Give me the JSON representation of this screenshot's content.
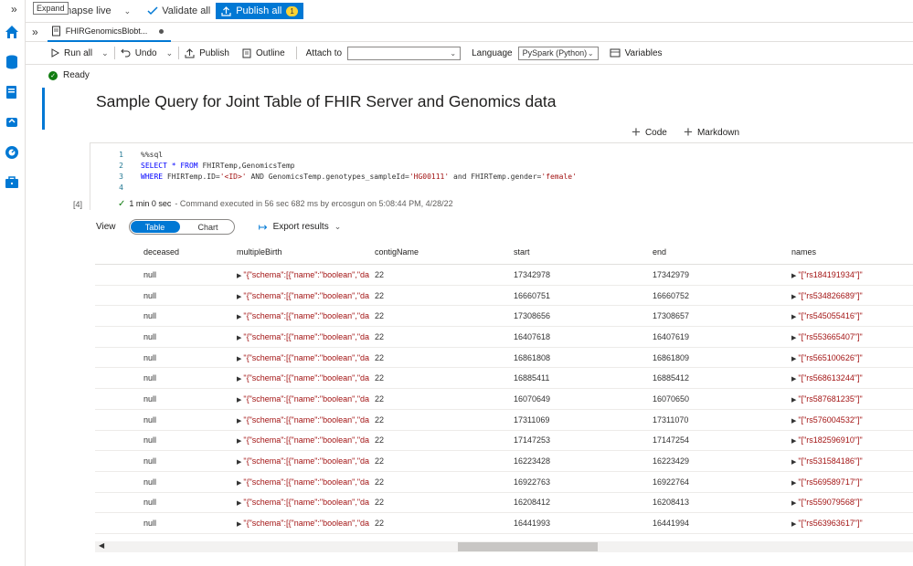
{
  "tooltip": "Expand",
  "topbar": {
    "workspace": "nnapse live",
    "validate_label": "Validate all",
    "publish_label": "Publish all",
    "publish_count": "1",
    "accent": "#0078d4"
  },
  "tab": {
    "label": "FHIRGenomicsBlobt..."
  },
  "toolbar": {
    "run_all": "Run all",
    "undo": "Undo",
    "publish": "Publish",
    "outline": "Outline",
    "attach_to_label": "Attach to",
    "attach_to_value": "",
    "language_label": "Language",
    "language_value": "PySpark (Python)",
    "variables": "Variables"
  },
  "status": "Ready",
  "title": "Sample Query for Joint Table of FHIR Server and Genomics data",
  "add": {
    "code": "Code",
    "markdown": "Markdown"
  },
  "code": {
    "line_numbers": [
      "1",
      "2",
      "3",
      "4"
    ],
    "line1": "%%sql",
    "line2_kw": "SELECT * FROM",
    "line2_rest": " FHIRTemp,GenomicsTemp",
    "line3_kw": "WHERE",
    "line3_a": " FHIRTemp.ID=",
    "line3_s1": "'<ID>'",
    "line3_b": " AND GenomicsTemp.genotypes_sampleId=",
    "line3_s2": "'HG00111'",
    "line3_c": " and FHIRTemp.gender=",
    "line3_s3": "'female'"
  },
  "execution": {
    "count": "[4]",
    "duration": "1 min 0 sec",
    "detail": "- Command executed in 56 sec 682 ms by ercosgun on 5:08:44 PM, 4/28/22"
  },
  "view": {
    "label": "View",
    "table": "Table",
    "chart": "Chart",
    "export": "Export results"
  },
  "table": {
    "headers": [
      "deceased",
      "multipleBirth",
      "contigName",
      "start",
      "end",
      "names"
    ],
    "rows": [
      [
        "null",
        "\"{\"schema\":[{\"name\":\"boolean\",\"da",
        "22",
        "17342978",
        "17342979",
        "\"[\"rs184191934\"]\""
      ],
      [
        "null",
        "\"{\"schema\":[{\"name\":\"boolean\",\"da",
        "22",
        "16660751",
        "16660752",
        "\"[\"rs534826689\"]\""
      ],
      [
        "null",
        "\"{\"schema\":[{\"name\":\"boolean\",\"da",
        "22",
        "17308656",
        "17308657",
        "\"[\"rs545055416\"]\""
      ],
      [
        "null",
        "\"{\"schema\":[{\"name\":\"boolean\",\"da",
        "22",
        "16407618",
        "16407619",
        "\"[\"rs553665407\"]\""
      ],
      [
        "null",
        "\"{\"schema\":[{\"name\":\"boolean\",\"da",
        "22",
        "16861808",
        "16861809",
        "\"[\"rs565100626\"]\""
      ],
      [
        "null",
        "\"{\"schema\":[{\"name\":\"boolean\",\"da",
        "22",
        "16885411",
        "16885412",
        "\"[\"rs568613244\"]\""
      ],
      [
        "null",
        "\"{\"schema\":[{\"name\":\"boolean\",\"da",
        "22",
        "16070649",
        "16070650",
        "\"[\"rs587681235\"]\""
      ],
      [
        "null",
        "\"{\"schema\":[{\"name\":\"boolean\",\"da",
        "22",
        "17311069",
        "17311070",
        "\"[\"rs576004532\"]\""
      ],
      [
        "null",
        "\"{\"schema\":[{\"name\":\"boolean\",\"da",
        "22",
        "17147253",
        "17147254",
        "\"[\"rs182596910\"]\""
      ],
      [
        "null",
        "\"{\"schema\":[{\"name\":\"boolean\",\"da",
        "22",
        "16223428",
        "16223429",
        "\"[\"rs531584186\"]\""
      ],
      [
        "null",
        "\"{\"schema\":[{\"name\":\"boolean\",\"da",
        "22",
        "16922763",
        "16922764",
        "\"[\"rs569589717\"]\""
      ],
      [
        "null",
        "\"{\"schema\":[{\"name\":\"boolean\",\"da",
        "22",
        "16208412",
        "16208413",
        "\"[\"rs559079568\"]\""
      ],
      [
        "null",
        "\"{\"schema\":[{\"name\":\"boolean\",\"da",
        "22",
        "16441993",
        "16441994",
        "\"[\"rs563963617\"]\""
      ]
    ]
  }
}
